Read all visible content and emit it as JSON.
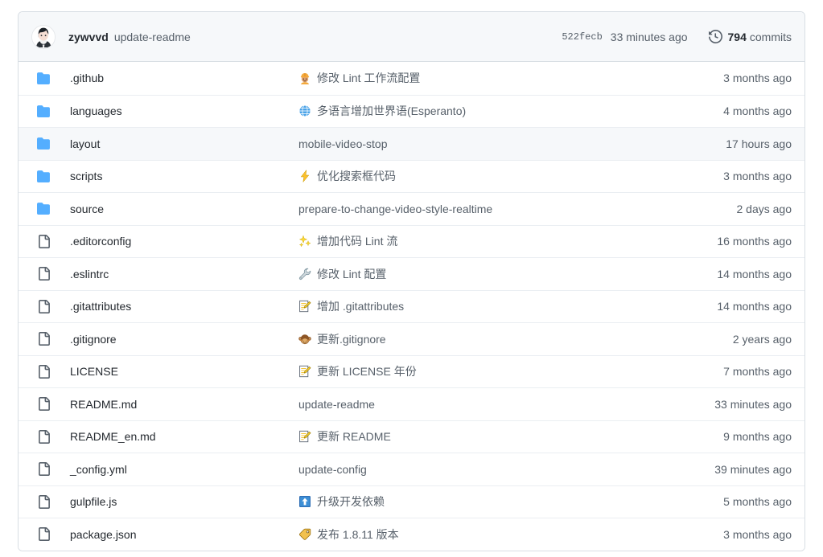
{
  "latest_commit": {
    "author": "zywvvd",
    "message": "update-readme",
    "sha": "522fecb",
    "age": "33 minutes ago",
    "commits_count": "794",
    "commits_label": "commits",
    "history_icon": "history-icon",
    "avatar_icon": "user-avatar"
  },
  "colors": {
    "folder_blue": "#54aeff",
    "file_gray": "#57606a",
    "link_muted": "#57606a",
    "name_dark": "#24292f",
    "header_bg": "#f6f8fa",
    "border": "#d8dee4",
    "row_border": "#eaeef2",
    "hover_bg": "#f6f8fa"
  },
  "rows": [
    {
      "icon": "folder-icon",
      "type": "folder",
      "name": ".github",
      "emoji": "construction-worker-emoji",
      "commit": "修改 Lint 工作流配置",
      "age": "3 months ago",
      "hovered": false
    },
    {
      "icon": "folder-icon",
      "type": "folder",
      "name": "languages",
      "emoji": "globe-emoji",
      "commit": "多语言增加世界语(Esperanto)",
      "age": "4 months ago",
      "hovered": false
    },
    {
      "icon": "folder-icon",
      "type": "folder",
      "name": "layout",
      "emoji": null,
      "commit": "mobile-video-stop",
      "age": "17 hours ago",
      "hovered": true
    },
    {
      "icon": "folder-icon",
      "type": "folder",
      "name": "scripts",
      "emoji": "zap-emoji",
      "commit": "优化搜索框代码",
      "age": "3 months ago",
      "hovered": false
    },
    {
      "icon": "folder-icon",
      "type": "folder",
      "name": "source",
      "emoji": null,
      "commit": "prepare-to-change-video-style-realtime",
      "age": "2 days ago",
      "hovered": false
    },
    {
      "icon": "file-icon",
      "type": "file",
      "name": ".editorconfig",
      "emoji": "sparkles-emoji",
      "commit": "增加代码 Lint 流",
      "age": "16 months ago",
      "hovered": false
    },
    {
      "icon": "file-icon",
      "type": "file",
      "name": ".eslintrc",
      "emoji": "wrench-emoji",
      "commit": "修改 Lint 配置",
      "age": "14 months ago",
      "hovered": false
    },
    {
      "icon": "file-icon",
      "type": "file",
      "name": ".gitattributes",
      "emoji": "memo-emoji",
      "commit": "增加 .gitattributes",
      "age": "14 months ago",
      "hovered": false
    },
    {
      "icon": "file-icon",
      "type": "file",
      "name": ".gitignore",
      "emoji": "see-no-evil-monkey-emoji",
      "commit": "更新.gitignore",
      "age": "2 years ago",
      "hovered": false
    },
    {
      "icon": "file-icon",
      "type": "file",
      "name": "LICENSE",
      "emoji": "memo-emoji",
      "commit": "更新 LICENSE 年份",
      "age": "7 months ago",
      "hovered": false
    },
    {
      "icon": "file-icon",
      "type": "file",
      "name": "README.md",
      "emoji": null,
      "commit": "update-readme",
      "age": "33 minutes ago",
      "hovered": false
    },
    {
      "icon": "file-icon",
      "type": "file",
      "name": "README_en.md",
      "emoji": "memo-emoji",
      "commit": "更新 README",
      "age": "9 months ago",
      "hovered": false
    },
    {
      "icon": "file-icon",
      "type": "file",
      "name": "_config.yml",
      "emoji": null,
      "commit": "update-config",
      "age": "39 minutes ago",
      "hovered": false
    },
    {
      "icon": "file-icon",
      "type": "file",
      "name": "gulpfile.js",
      "emoji": "arrow-up-emoji",
      "commit": "升级开发依赖",
      "age": "5 months ago",
      "hovered": false
    },
    {
      "icon": "file-icon",
      "type": "file",
      "name": "package.json",
      "emoji": "label-emoji",
      "commit": "发布 1.8.11 版本",
      "age": "3 months ago",
      "hovered": false
    }
  ]
}
